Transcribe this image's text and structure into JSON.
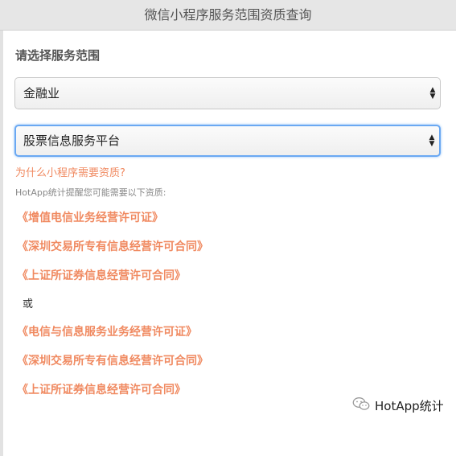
{
  "window": {
    "title": "微信小程序服务范围资质查询"
  },
  "form": {
    "section_label": "请选择服务范围",
    "category_select": {
      "value": "金融业"
    },
    "subcategory_select": {
      "value": "股票信息服务平台"
    },
    "select_arrows": "▲▼"
  },
  "why_link": "为什么小程序需要资质?",
  "hint": "HotApp统计提醒您可能需要以下资质:",
  "qualifications_a": [
    "《增值电信业务经营许可证》",
    "《深圳交易所专有信息经营许可合同》",
    "《上证所证券信息经营许可合同》"
  ],
  "or_text": "或",
  "qualifications_b": [
    "《电信与信息服务业务经营许可证》",
    "《深圳交易所专有信息经营许可合同》",
    "《上证所证券信息经营许可合同》"
  ],
  "watermark": {
    "icon": "wechat-icon",
    "text": "HotApp统计"
  },
  "colors": {
    "accent": "#f08a61",
    "focus": "#6aa8f2",
    "titlebar": "#e6e6e6"
  }
}
